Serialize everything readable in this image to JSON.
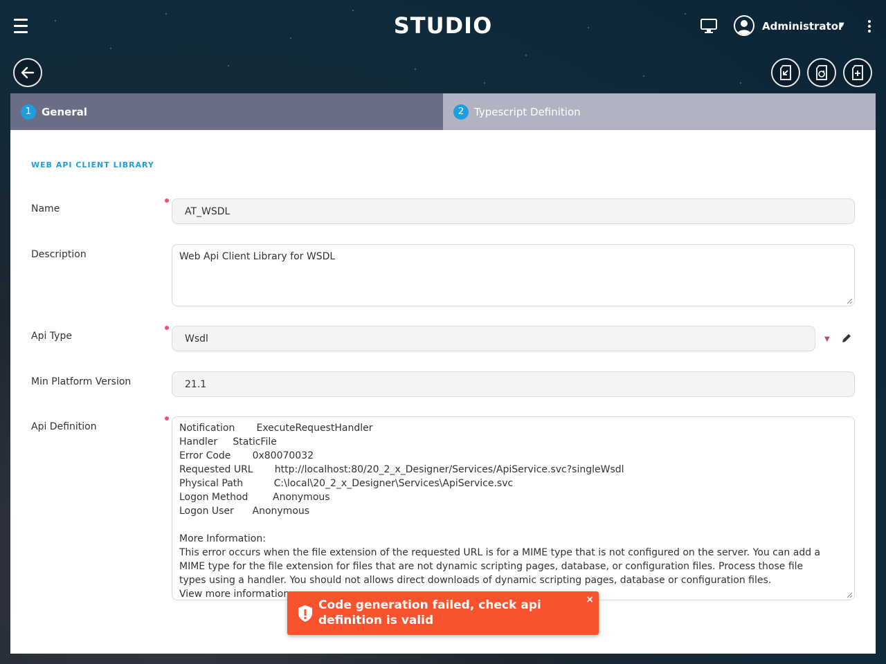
{
  "header": {
    "app_title": "STUDIO",
    "user_name": "Administrator",
    "icons": [
      "hamburger-icon",
      "monitor-icon",
      "user-avatar-icon",
      "kebab-icon"
    ]
  },
  "toolbar": {
    "icons": [
      "back-arrow-icon",
      "import-icon",
      "reload-icon",
      "new-file-icon"
    ]
  },
  "tabs": [
    {
      "number": "1",
      "label": "General"
    },
    {
      "number": "2",
      "label": "Typescript Definition"
    }
  ],
  "form": {
    "section_title": "WEB API CLIENT LIBRARY",
    "name_label": "Name",
    "name_value": "AT_WSDL",
    "description_label": "Description",
    "description_value": "Web Api Client Library for WSDL",
    "api_type_label": "Api Type",
    "api_type_value": "Wsdl",
    "min_platform_label": "Min Platform Version",
    "min_platform_value": "21.1",
    "api_definition_label": "Api Definition",
    "api_definition_value": "Notification       ExecuteRequestHandler\nHandler     StaticFile\nError Code       0x80070032\nRequested URL       http://localhost:80/20_2_x_Designer/Services/ApiService.svc?singleWsdl\nPhysical Path          C:\\local\\20_2_x_Designer\\Services\\ApiService.svc\nLogon Method        Anonymous\nLogon User      Anonymous\n\nMore Information:\nThis error occurs when the file extension of the requested URL is for a MIME type that is not configured on the server. You can add a MIME type for the file extension for files that are not dynamic scripting pages, database, or configuration files. Process those file types using a handler. You should not allows direct downloads of dynamic scripting pages, database or configuration files.\nView more information"
  },
  "toast": {
    "message": "Code generation failed, check api definition is valid",
    "close": "×",
    "color": "#f8532f"
  },
  "colors": {
    "accent": "#1e9ee0",
    "active_tab": "#6a6d86",
    "inactive_tab": "#b2b3c2",
    "required_dot": "#f0506e"
  }
}
